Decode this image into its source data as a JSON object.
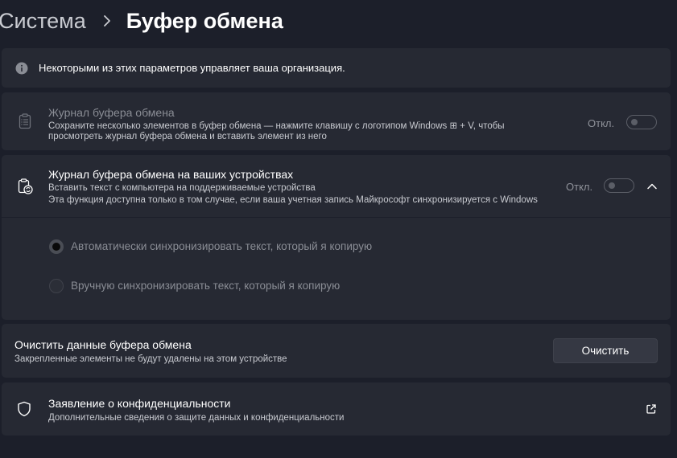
{
  "breadcrumb": {
    "parent": "Система",
    "current": "Буфер обмена"
  },
  "notice": {
    "icon": "info-icon",
    "text": "Некоторыми из этих параметров управляет ваша организация."
  },
  "history": {
    "icon": "clipboard-list-icon",
    "title": "Журнал буфера обмена",
    "desc_line1": "Сохраните несколько элементов в буфер обмена — нажмите клавишу с логотипом Windows ⊞ + V, чтобы",
    "desc_line2": "просмотреть журнал буфера обмена и вставить элемент из него",
    "toggle_label": "Откл.",
    "toggle_on": false,
    "disabled": true
  },
  "devices": {
    "icon": "clipboard-sync-icon",
    "title": "Журнал буфера обмена на ваших устройствах",
    "desc_line1": "Вставить текст с компьютера на поддерживаемые устройства",
    "desc_line2": "Эта функция доступна только в том случае, если ваша учетная запись Майкрософт синхронизируется с Windows",
    "toggle_label": "Откл.",
    "toggle_on": false,
    "expanded": true,
    "options": [
      {
        "label": "Автоматически синхронизировать текст, который я копирую",
        "selected": true
      },
      {
        "label": "Вручную синхронизировать текст, который я копирую",
        "selected": false
      }
    ]
  },
  "clear": {
    "title": "Очистить данные буфера обмена",
    "desc": "Закрепленные элементы не будут удалены на этом устройстве",
    "button_label": "Очистить"
  },
  "privacy": {
    "icon": "shield-icon",
    "title": "Заявление о конфиденциальности",
    "desc": "Дополнительные сведения о защите данных и конфиденциальности",
    "link_icon": "external-link-icon"
  },
  "colors": {
    "background": "#1c1f2a",
    "card": "#262933",
    "text": "#ffffff",
    "muted": "#8a8d95"
  }
}
